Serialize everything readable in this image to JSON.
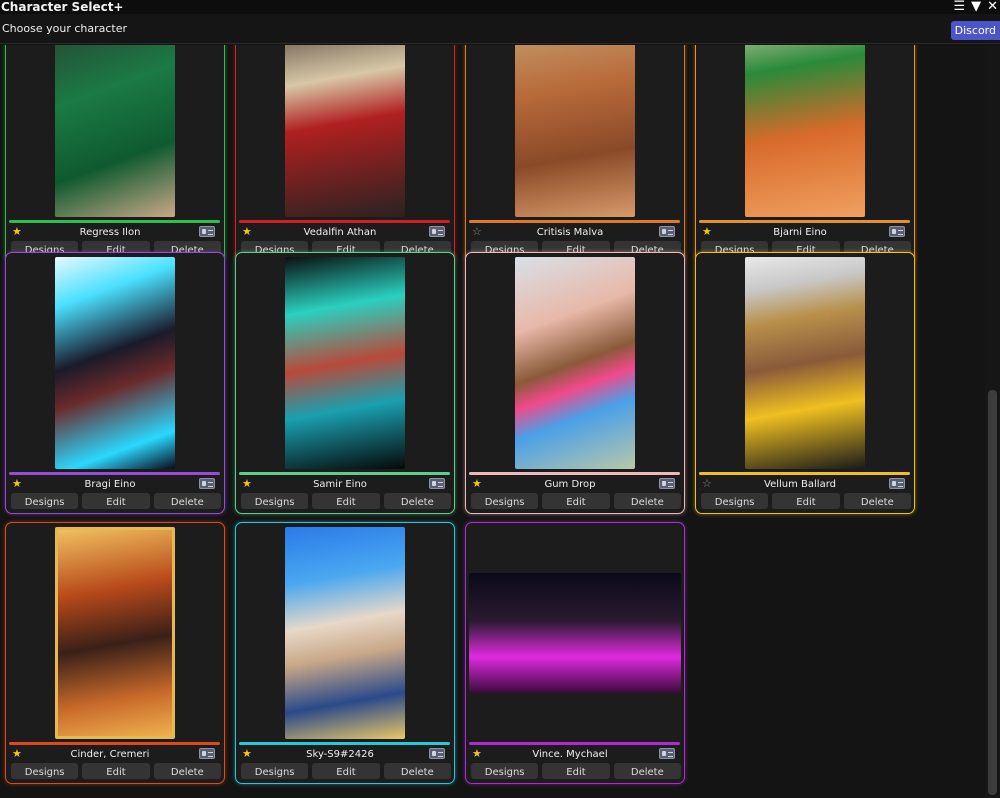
{
  "window": {
    "title": "Character Select+",
    "subtitle": "Choose your character",
    "discord_label": "Discord"
  },
  "buttons": {
    "designs": "Designs",
    "edit": "Edit",
    "delete": "Delete"
  },
  "characters": [
    {
      "name": "Regress Ilon",
      "favorite": true,
      "color": "#2ec04a"
    },
    {
      "name": "Vedalfin Athan",
      "favorite": true,
      "color": "#d21f1f"
    },
    {
      "name": "Critisis Malva",
      "favorite": false,
      "color": "#e07a22"
    },
    {
      "name": "Bjarni Eino",
      "favorite": true,
      "color": "#e8902a"
    },
    {
      "name": "Bragi Eino",
      "favorite": true,
      "color": "#9a4ad8"
    },
    {
      "name": "Samir Eino",
      "favorite": true,
      "color": "#5ad08a"
    },
    {
      "name": "Gum Drop",
      "favorite": true,
      "color": "#f0b8b8"
    },
    {
      "name": "Vellum Ballard",
      "favorite": false,
      "color": "#f0c020"
    },
    {
      "name": "Cinder, Cremeri",
      "favorite": true,
      "color": "#e04a1a"
    },
    {
      "name": "Sky-S9#2426",
      "favorite": true,
      "color": "#28c8d8"
    },
    {
      "name": "Vince. Mychael",
      "favorite": true,
      "color": "#b02ad0"
    }
  ],
  "star_on": "★",
  "star_off": "☆"
}
